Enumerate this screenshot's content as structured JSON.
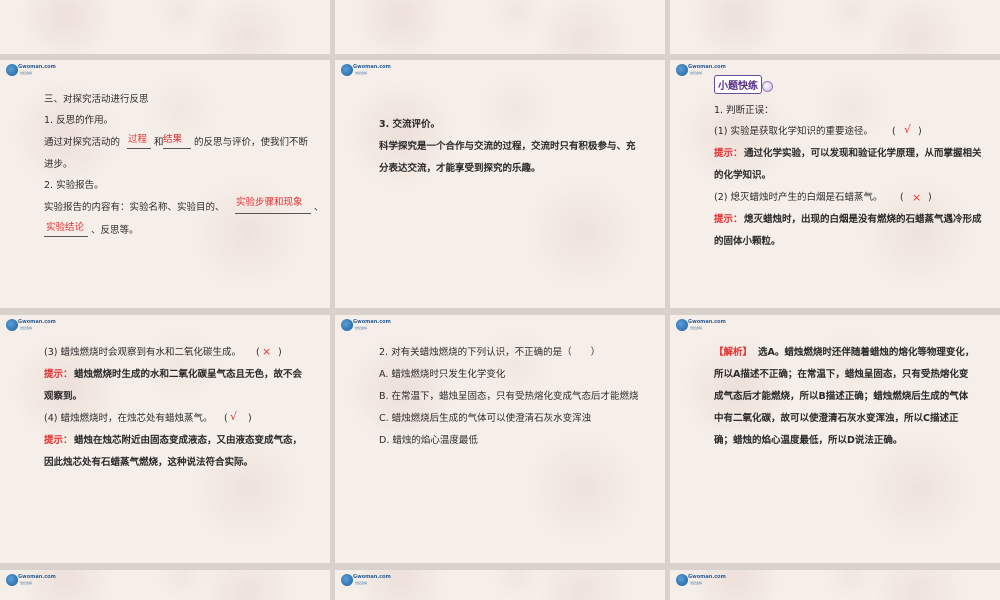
{
  "logo": {
    "word": "Gwoman.com",
    "sub": "世纪金榜"
  },
  "s1": {
    "heading": "三、对探究活动进行反思",
    "item1": "1. 反思的作用。",
    "line2_a": "通过对探究活动的",
    "fill_a": "过程",
    "line2_b": "和",
    "fill_b": "结果",
    "line2_c": "的反思与评价，使我们不断",
    "line3": "进步。",
    "item2": "2. 实验报告。",
    "line5_a": "实验报告的内容有：实验名称、实验目的、",
    "fill_c": "实验步骤和现象",
    "line5_b": "、",
    "fill_d": "实验结论",
    "line6_b": "、反思等。"
  },
  "s2": {
    "heading": "3. 交流评价。",
    "line1": "科学探究是一个合作与交流的过程，交流时只有积极参与、充",
    "line2": "分表达交流，才能享受到探究的乐趣。"
  },
  "s3": {
    "badge": "小题快练",
    "q": "1. 判断正误：",
    "q1": "(1) 实验是获取化学知识的重要途径。",
    "q1_mark": "√",
    "h1_label": "提示：",
    "h1a": "通过化学实验，可以发现和验证化学原理，从而掌握相关",
    "h1b": "的化学知识。",
    "q2": "(2) 熄灭蜡烛时产生的白烟是石蜡蒸气。",
    "q2_mark": "×",
    "h2_label": "提示：",
    "h2a": "熄灭蜡烛时，出现的白烟是没有燃烧的石蜡蒸气遇冷形成",
    "h2b": "的固体小颗粒。"
  },
  "s4": {
    "q3": "(3) 蜡烛燃烧时会观察到有水和二氧化碳生成。",
    "q3_mark": "×",
    "h3_label": "提示：",
    "h3a": "蜡烛燃烧时生成的水和二氧化碳呈气态且无色，故不会",
    "h3b": "观察到。",
    "q4": "(4) 蜡烛燃烧时，在烛芯处有蜡烛蒸气。",
    "q4_mark": "√",
    "h4_label": "提示：",
    "h4a": "蜡烛在烛芯附近由固态变成液态，又由液态变成气态，",
    "h4b": "因此烛芯处有石蜡蒸气燃烧，这种说法符合实际。"
  },
  "s5": {
    "q": "2. 对有关蜡烛燃烧的下列认识，不正确的是（　　）",
    "a": "A. 蜡烛燃烧时只发生化学变化",
    "b": "B. 在常温下，蜡烛呈固态，只有受热熔化变成气态后才能燃烧",
    "c": "C. 蜡烛燃烧后生成的气体可以使澄清石灰水变浑浊",
    "d": "D. 蜡烛的焰心温度最低"
  },
  "s6": {
    "label": "【解析】",
    "l1": "选A。蜡烛燃烧时还伴随着蜡烛的熔化等物理变化，",
    "l2": "所以A描述不正确；在常温下，蜡烛呈固态，只有受热熔化变",
    "l3": "成气态后才能燃烧，所以B描述正确；蜡烛燃烧后生成的气体",
    "l4": "中有二氧化碳，故可以使澄清石灰水变浑浊，所以C描述正",
    "l5": "确；蜡烛的焰心温度最低，所以D说法正确。"
  },
  "colors": {
    "accent_red": "#e03030",
    "badge_purple": "#5a2f8a",
    "background": "#d9d2cc"
  }
}
